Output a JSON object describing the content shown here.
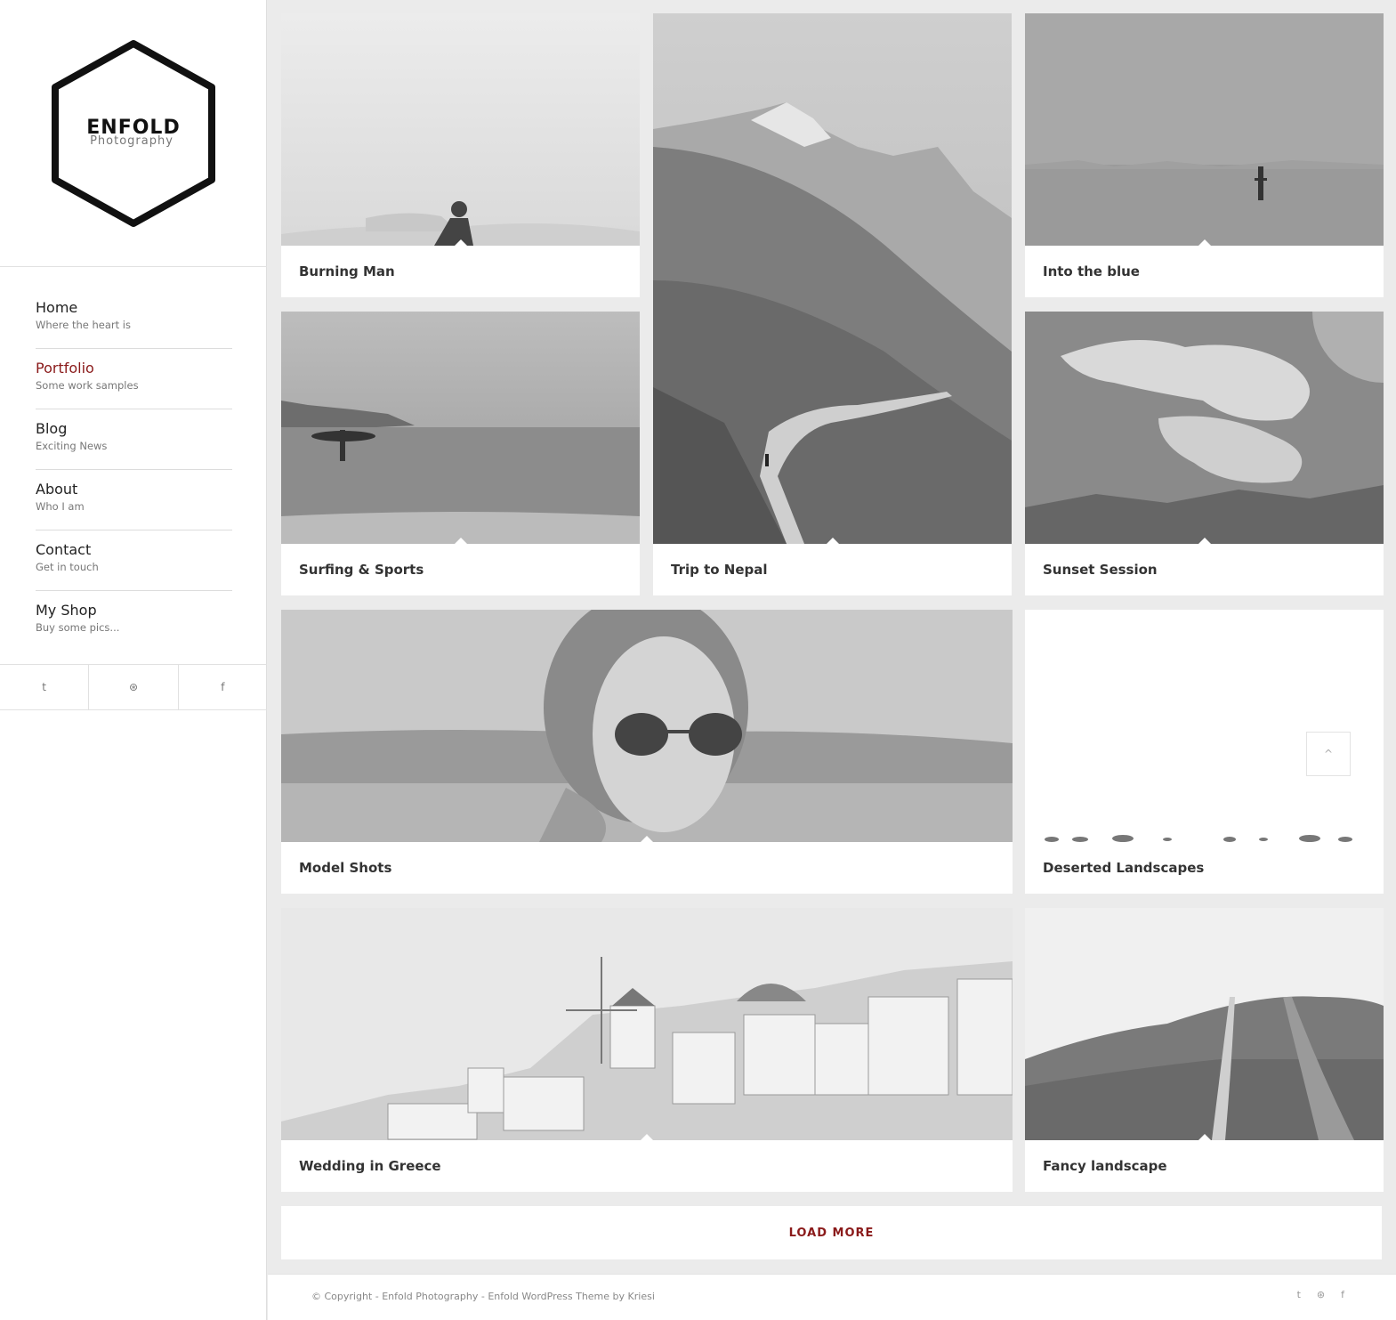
{
  "logo": {
    "title": "ENFOLD",
    "subtitle": "Photography"
  },
  "nav": [
    {
      "label": "Home",
      "sub": "Where the heart is",
      "active": false
    },
    {
      "label": "Portfolio",
      "sub": "Some work samples",
      "active": true
    },
    {
      "label": "Blog",
      "sub": "Exciting News",
      "active": false
    },
    {
      "label": "About",
      "sub": "Who I am",
      "active": false
    },
    {
      "label": "Contact",
      "sub": "Get in touch",
      "active": false
    },
    {
      "label": "My Shop",
      "sub": "Buy some pics...",
      "active": false
    }
  ],
  "social": [
    {
      "icon": "twitter-icon",
      "glyph": "t"
    },
    {
      "icon": "dribbble-icon",
      "glyph": "⊛"
    },
    {
      "icon": "facebook-icon",
      "glyph": "f"
    }
  ],
  "portfolio": [
    {
      "title": "Burning Man"
    },
    {
      "title": "Trip to Nepal"
    },
    {
      "title": "Into the blue"
    },
    {
      "title": "Surfing & Sports"
    },
    {
      "title": "Sunset Session"
    },
    {
      "title": "Model Shots"
    },
    {
      "title": "Deserted Landscapes"
    },
    {
      "title": "Wedding in Greece"
    },
    {
      "title": "Fancy landscape"
    }
  ],
  "load_more": "LOAD MORE",
  "scroll_top": "^",
  "footer": {
    "text": "© Copyright - Enfold Photography - Enfold WordPress Theme by Kriesi",
    "icons": [
      {
        "icon": "twitter-icon",
        "glyph": "t"
      },
      {
        "icon": "dribbble-icon",
        "glyph": "⊛"
      },
      {
        "icon": "facebook-icon",
        "glyph": "f"
      }
    ]
  },
  "colors": {
    "accent": "#8a1a1a",
    "background": "#ebebeb"
  }
}
